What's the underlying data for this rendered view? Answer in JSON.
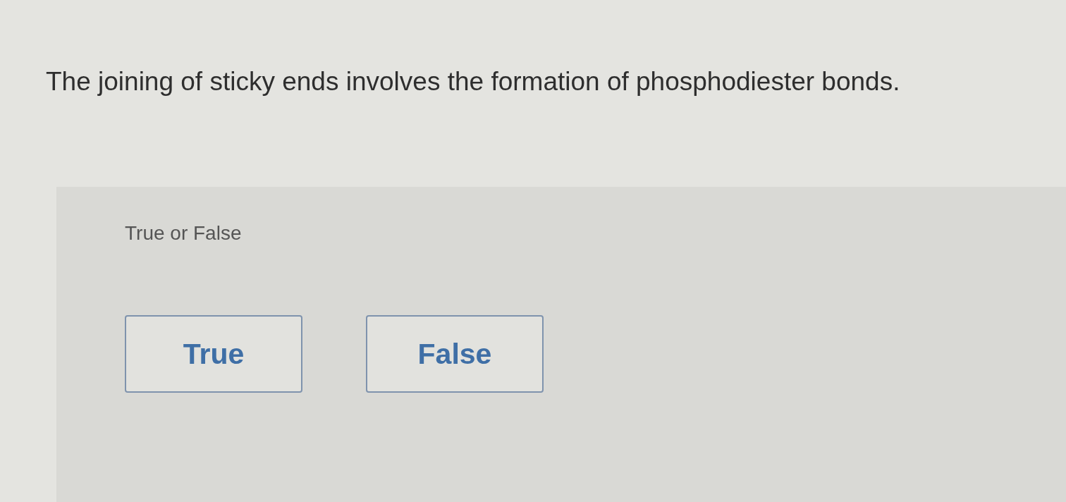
{
  "question": {
    "text": "The joining of sticky ends involves the formation of phosphodiester bonds."
  },
  "answer_panel": {
    "prompt": "True or False",
    "options": [
      {
        "label": "True",
        "selected": false
      },
      {
        "label": "False",
        "selected": false
      }
    ]
  }
}
